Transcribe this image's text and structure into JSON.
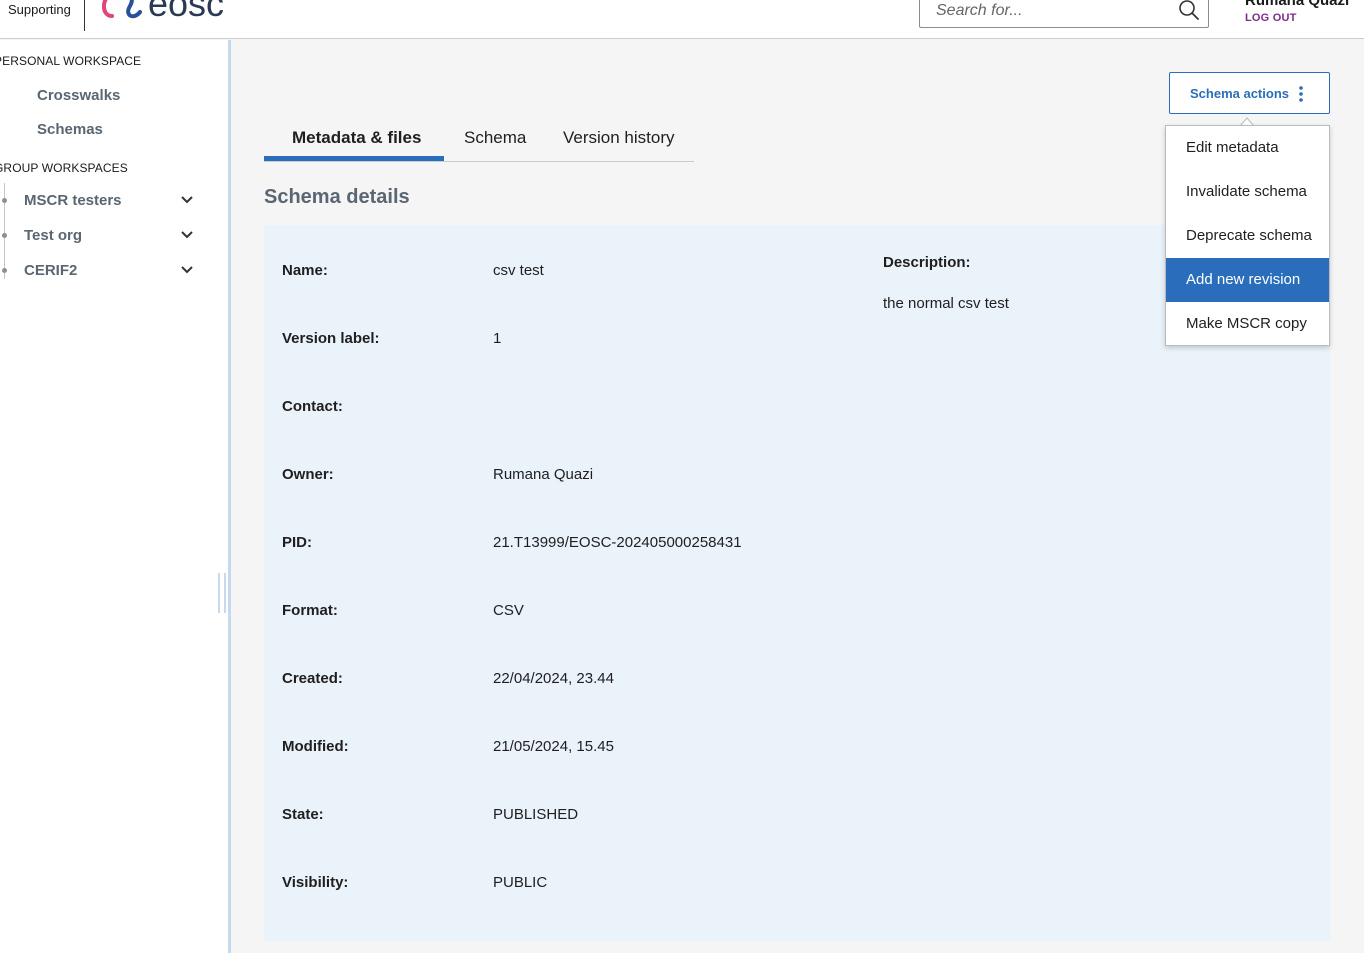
{
  "header": {
    "supporting_text": "Supporting",
    "logo_text": "eosc",
    "search": {
      "placeholder": "Search for..."
    },
    "user": {
      "name": "Rumana Quazi",
      "logout_label": "LOG OUT"
    }
  },
  "sidebar": {
    "personal_heading": "PERSONAL WORKSPACE",
    "personal_items": [
      {
        "label": "Crosswalks"
      },
      {
        "label": "Schemas"
      }
    ],
    "group_heading": "GROUP WORKSPACES",
    "group_items": [
      {
        "label": "MSCR testers"
      },
      {
        "label": "Test org"
      },
      {
        "label": "CERIF2"
      }
    ]
  },
  "main": {
    "schema_actions_label": "Schema actions",
    "tabs": [
      {
        "label": "Metadata & files",
        "active": true
      },
      {
        "label": "Schema",
        "active": false
      },
      {
        "label": "Version history",
        "active": false
      }
    ],
    "section_title": "Schema details",
    "fields": [
      {
        "label": "Name:",
        "value": "csv test"
      },
      {
        "label": "Version label:",
        "value": "1"
      },
      {
        "label": "Contact:",
        "value": ""
      },
      {
        "label": "Owner:",
        "value": "Rumana Quazi"
      },
      {
        "label": "PID:",
        "value": "21.T13999/EOSC-202405000258431"
      },
      {
        "label": "Format:",
        "value": "CSV"
      },
      {
        "label": "Created:",
        "value": "22/04/2024, 23.44"
      },
      {
        "label": "Modified:",
        "value": "21/05/2024, 15.45"
      },
      {
        "label": "State:",
        "value": "PUBLISHED"
      },
      {
        "label": "Visibility:",
        "value": "PUBLIC"
      }
    ],
    "description": {
      "label": "Description:",
      "value": "the normal csv test"
    }
  },
  "actions_menu": {
    "items": [
      {
        "label": "Edit metadata"
      },
      {
        "label": "Invalidate schema"
      },
      {
        "label": "Deprecate schema"
      },
      {
        "label": "Add new revision",
        "highlighted": true
      },
      {
        "label": "Make MSCR copy"
      }
    ]
  },
  "colors": {
    "accent": "#2a6ebb",
    "panel_background": "#eaf2fa",
    "logout": "#7b2d8b",
    "logo_pink": "#e0457b",
    "logo_blue": "#2a4f9b"
  }
}
